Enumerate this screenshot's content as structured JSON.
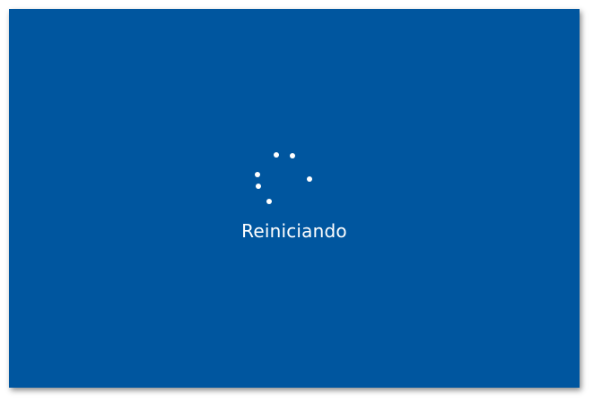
{
  "screen": {
    "background_color": "#00569f",
    "status_text": "Reiniciando"
  },
  "spinner": {
    "icon": "loading-spinner-icon",
    "dot_color": "#ffffff",
    "dot_count": 6
  }
}
